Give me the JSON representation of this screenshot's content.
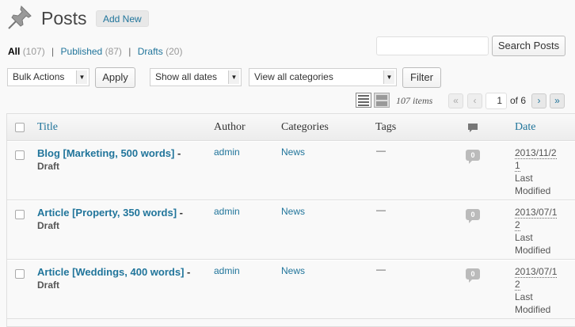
{
  "header": {
    "title": "Posts",
    "add_new": "Add New",
    "icon": "pushpin-icon"
  },
  "filters": {
    "all_label": "All",
    "all_count": "(107)",
    "published_label": "Published",
    "published_count": "(87)",
    "drafts_label": "Drafts",
    "drafts_count": "(20)",
    "sep": "|"
  },
  "search": {
    "value": "",
    "button": "Search Posts"
  },
  "bulk": {
    "selected": "Bulk Actions",
    "apply": "Apply"
  },
  "date_filter": {
    "selected": "Show all dates"
  },
  "category_filter": {
    "selected": "View all categories"
  },
  "filter_button": "Filter",
  "pagination": {
    "items": "107 items",
    "first": "«",
    "prev": "‹",
    "current": "1",
    "of": "of 6",
    "next": "›",
    "last": "»"
  },
  "table": {
    "columns": {
      "title": "Title",
      "author": "Author",
      "categories": "Categories",
      "tags": "Tags",
      "comments_icon": "comment-icon",
      "date": "Date"
    },
    "rows": [
      {
        "title": "Blog [Marketing, 500 words]",
        "dash": " -",
        "state": "Draft",
        "author": "admin",
        "category": "News",
        "tags": "—",
        "comments": "0",
        "date_a": "2013/11/2",
        "date_b": "1",
        "date_status": "Last Modified"
      },
      {
        "title": "Article [Property, 350 words]",
        "dash": " -",
        "state": "Draft",
        "author": "admin",
        "category": "News",
        "tags": "—",
        "comments": "0",
        "date_a": "2013/07/1",
        "date_b": "2",
        "date_status": "Last Modified"
      },
      {
        "title": "Article [Weddings, 400 words]",
        "dash": " -",
        "state": "Draft",
        "author": "admin",
        "category": "News",
        "tags": "—",
        "comments": "0",
        "date_a": "2013/07/1",
        "date_b": "2",
        "date_status": "Last Modified"
      }
    ]
  },
  "colors": {
    "link": "#21759b",
    "background": "#f9f9f9",
    "bubble": "#bbbbbb"
  }
}
